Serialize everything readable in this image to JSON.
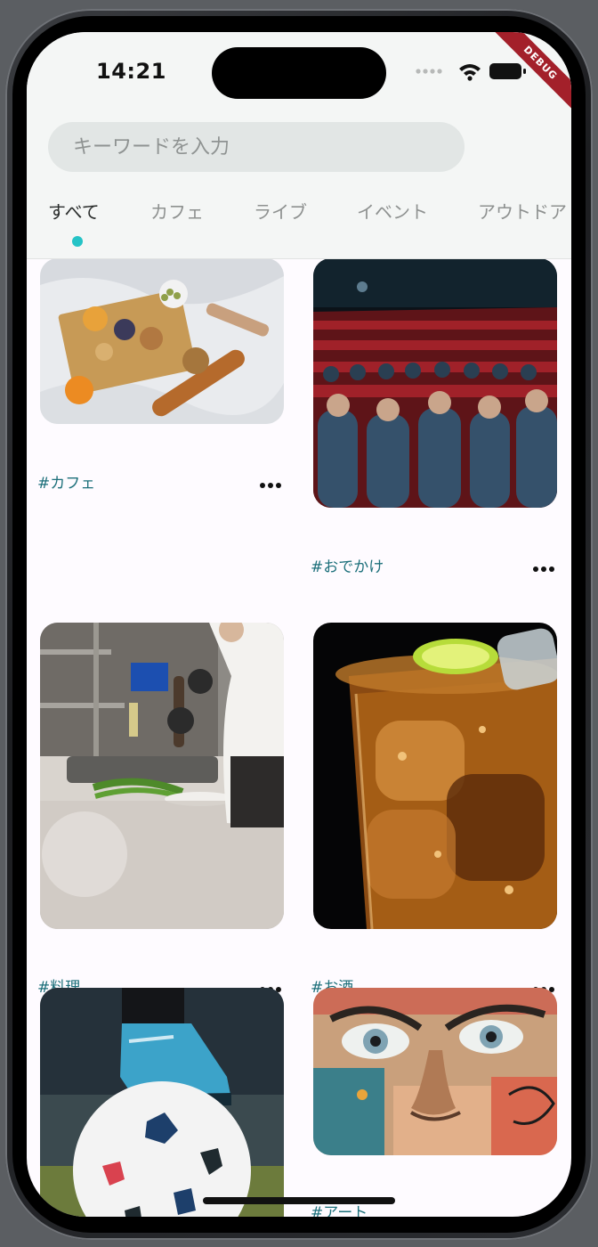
{
  "status_bar": {
    "time": "14:21",
    "debug_label": "DEBUG",
    "icons": [
      "signal-dots-icon",
      "wifi-icon",
      "battery-icon"
    ]
  },
  "search": {
    "placeholder": "キーワードを入力",
    "value": ""
  },
  "tabs": [
    {
      "label": "すべて",
      "active": true
    },
    {
      "label": "カフェ",
      "active": false
    },
    {
      "label": "ライブ",
      "active": false
    },
    {
      "label": "イベント",
      "active": false
    },
    {
      "label": "アウトドア",
      "active": false
    }
  ],
  "posts": [
    {
      "tag": "#カフェ",
      "image": "picnic-spread-image",
      "more_icon": "more-dots-icon"
    },
    {
      "tag": "#おでかけ",
      "image": "theater-audience-image",
      "more_icon": "more-dots-icon"
    },
    {
      "tag": "#料理",
      "image": "chef-cooking-image",
      "more_icon": "more-dots-icon"
    },
    {
      "tag": "#お酒",
      "image": "iced-drink-image",
      "more_icon": "more-dots-icon"
    },
    {
      "tag": "",
      "image": "soccer-ball-image",
      "more_icon": ""
    },
    {
      "tag": "#アート",
      "image": "street-art-face-image",
      "more_icon": "more-dots-icon"
    }
  ],
  "colors": {
    "accent": "#25c3c6",
    "tag_text": "#1c6f7a",
    "header_bg": "#f4f6f5",
    "search_bg": "#e2e6e5",
    "debug_banner": "#a3202a"
  }
}
